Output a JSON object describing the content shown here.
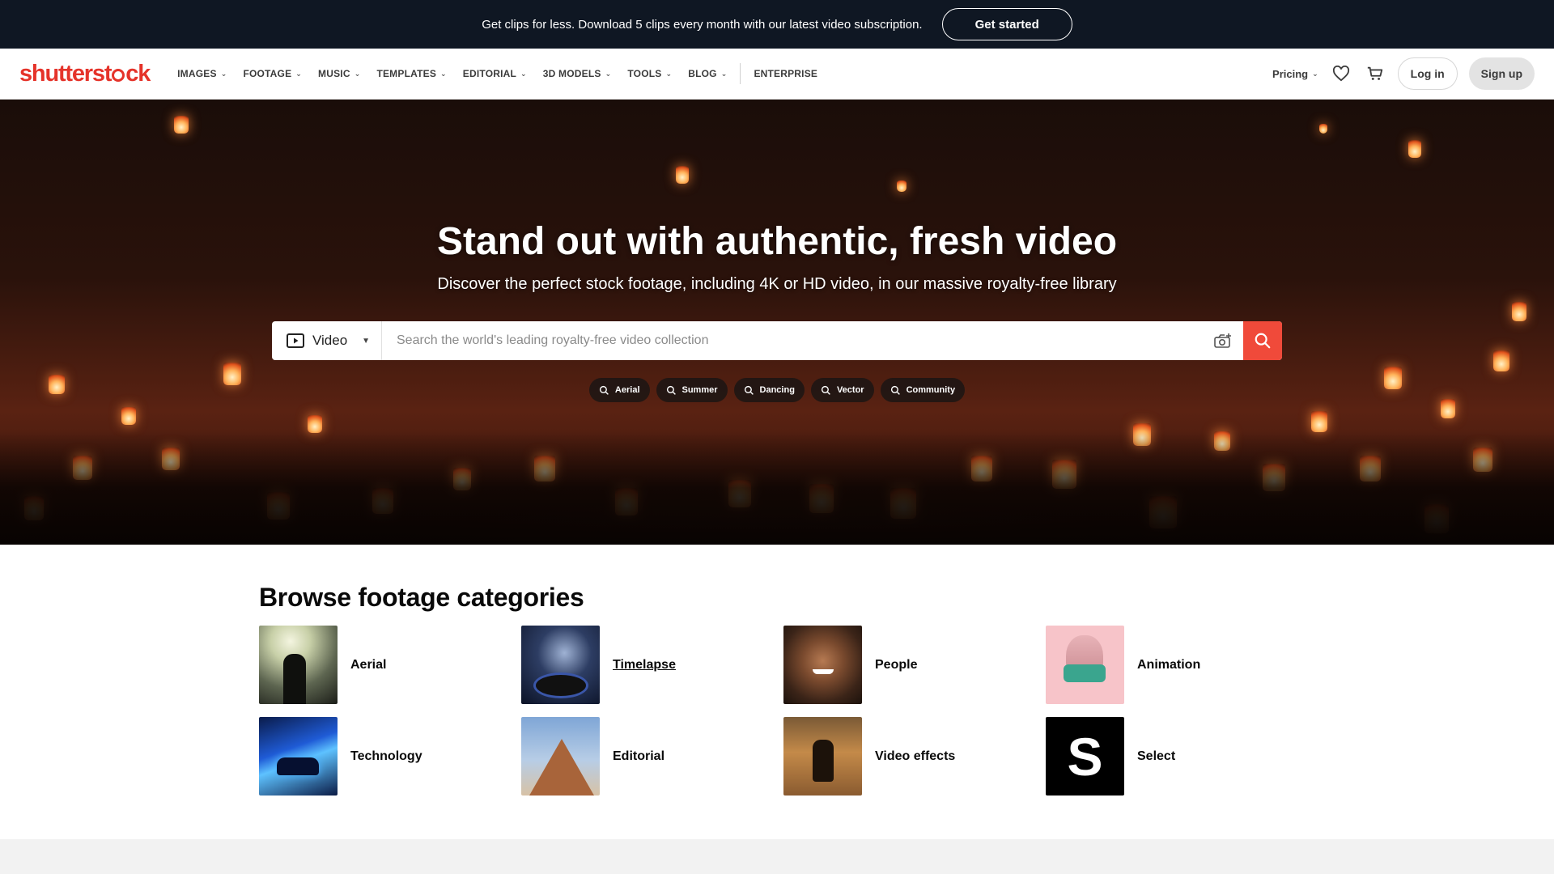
{
  "promo": {
    "text": "Get clips for less. Download 5 clips every month with our latest video subscription.",
    "cta": "Get started"
  },
  "nav": {
    "logo": {
      "prefix": "shutterst",
      "suffix": "ck"
    },
    "menu": [
      {
        "label": "IMAGES"
      },
      {
        "label": "FOOTAGE"
      },
      {
        "label": "MUSIC"
      },
      {
        "label": "TEMPLATES"
      },
      {
        "label": "EDITORIAL"
      },
      {
        "label": "3D MODELS"
      },
      {
        "label": "TOOLS"
      },
      {
        "label": "BLOG"
      }
    ],
    "enterprise": "ENTERPRISE",
    "pricing": "Pricing",
    "login": "Log in",
    "signup": "Sign up"
  },
  "hero": {
    "title": "Stand out with authentic, fresh video",
    "subtitle": "Discover the perfect stock footage, including 4K or HD video, in our massive royalty-free library",
    "search": {
      "type": "Video",
      "placeholder": "Search the world's leading royalty-free video collection"
    },
    "chips": [
      "Aerial",
      "Summer",
      "Dancing",
      "Vector",
      "Community"
    ]
  },
  "categories": {
    "title": "Browse footage categories",
    "items": [
      {
        "label": "Aerial"
      },
      {
        "label": "Timelapse"
      },
      {
        "label": "People"
      },
      {
        "label": "Animation"
      },
      {
        "label": "Technology"
      },
      {
        "label": "Editorial"
      },
      {
        "label": "Video effects"
      },
      {
        "label": "Select",
        "thumb_text": "S"
      }
    ]
  },
  "colors": {
    "brand": "#e5332a",
    "promo_bg": "#0f1723",
    "search_button": "#f04a3a"
  }
}
